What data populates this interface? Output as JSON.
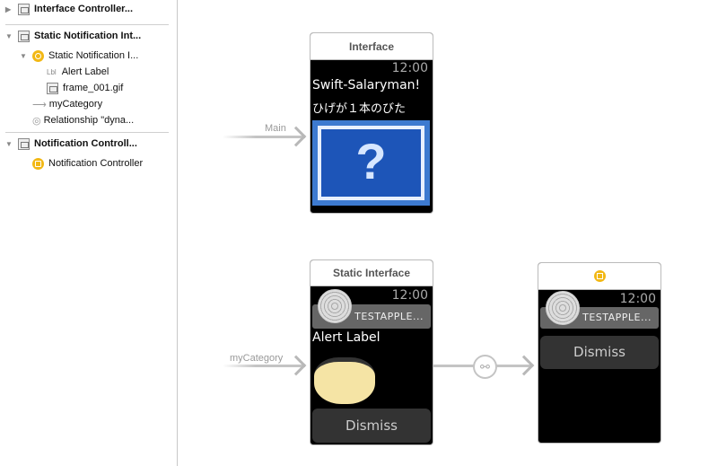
{
  "sidebar": {
    "items": [
      {
        "label": "Interface Controller...",
        "expanded": false
      },
      {
        "label": "Static Notification Int...",
        "expanded": true
      },
      {
        "label": "Static Notification I..."
      },
      {
        "label": "Alert Label",
        "badge": "Lbl"
      },
      {
        "label": "frame_001.gif"
      },
      {
        "label": "myCategory"
      },
      {
        "label": "Relationship \"dyna..."
      },
      {
        "label": "Notification Controll...",
        "expanded": true
      },
      {
        "label": "Notification Controller"
      }
    ]
  },
  "canvas": {
    "interface": {
      "title": "Interface",
      "time": "12:00",
      "line1": "Swift-Salaryman!",
      "line2": "ひげが１本のびた",
      "image": "question-mark-image"
    },
    "main_segue": {
      "label": "Main"
    },
    "static": {
      "title": "Static Interface",
      "time": "12:00",
      "app_name": "TESTAPPLE...",
      "alert_label": "Alert Label",
      "dismiss": "Dismiss"
    },
    "category_segue": {
      "label": "myCategory"
    },
    "dynamic": {
      "time": "12:00",
      "app_name": "TESTAPPLE...",
      "dismiss": "Dismiss"
    }
  },
  "colors": {
    "accent": "#f2b815",
    "segue": "#c4c4c4"
  }
}
